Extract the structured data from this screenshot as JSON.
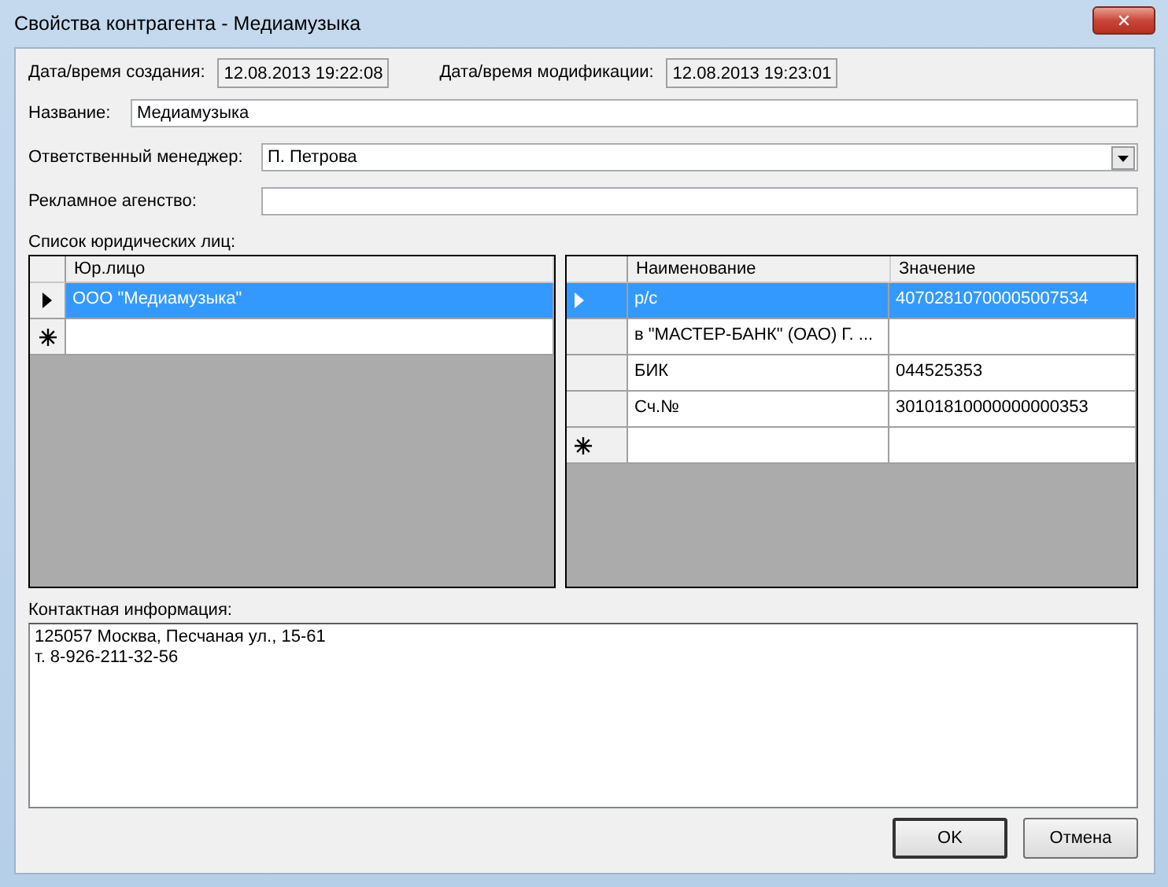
{
  "window": {
    "title": "Свойства контрагента - Медиамузыка",
    "close_glyph": "✕"
  },
  "created": {
    "label": "Дата/время создания:",
    "value": "12.08.2013 19:22:08"
  },
  "modified": {
    "label": "Дата/время модификации:",
    "value": "12.08.2013 19:23:01"
  },
  "name": {
    "label": "Название:",
    "value": "Медиамузыка"
  },
  "manager": {
    "label": "Ответственный менеджер:",
    "value": "П. Петрова"
  },
  "agency": {
    "label": "Рекламное агенство:"
  },
  "legal_list": {
    "label": "Список юридических лиц:",
    "entities": {
      "columns": [
        "Юр.лицо"
      ],
      "rows": [
        {
          "kind": "data",
          "selected": true,
          "cells": [
            "ООО \"Медиамузыка\""
          ]
        },
        {
          "kind": "new",
          "selected": false,
          "cells": [
            ""
          ]
        }
      ]
    },
    "details": {
      "columns": [
        "Наименование",
        "Значение"
      ],
      "rows": [
        {
          "kind": "data",
          "selected": true,
          "cells": [
            "р/с",
            "40702810700005007534"
          ]
        },
        {
          "kind": "data",
          "selected": false,
          "cells": [
            "в \"МАСТЕР-БАНК\" (ОАО) Г. ...",
            ""
          ]
        },
        {
          "kind": "data",
          "selected": false,
          "cells": [
            "БИК",
            "044525353"
          ]
        },
        {
          "kind": "data",
          "selected": false,
          "cells": [
            "Сч.№",
            "30101810000000000353"
          ]
        },
        {
          "kind": "new",
          "selected": false,
          "cells": [
            "",
            ""
          ]
        }
      ]
    }
  },
  "contact": {
    "label": "Контактная информация:",
    "value": "125057 Москва, Песчаная ул., 15-61\nт. 8-926-211-32-56"
  },
  "buttons": [
    {
      "label": "OK",
      "default": true
    },
    {
      "label": "Отмена",
      "default": false
    }
  ]
}
